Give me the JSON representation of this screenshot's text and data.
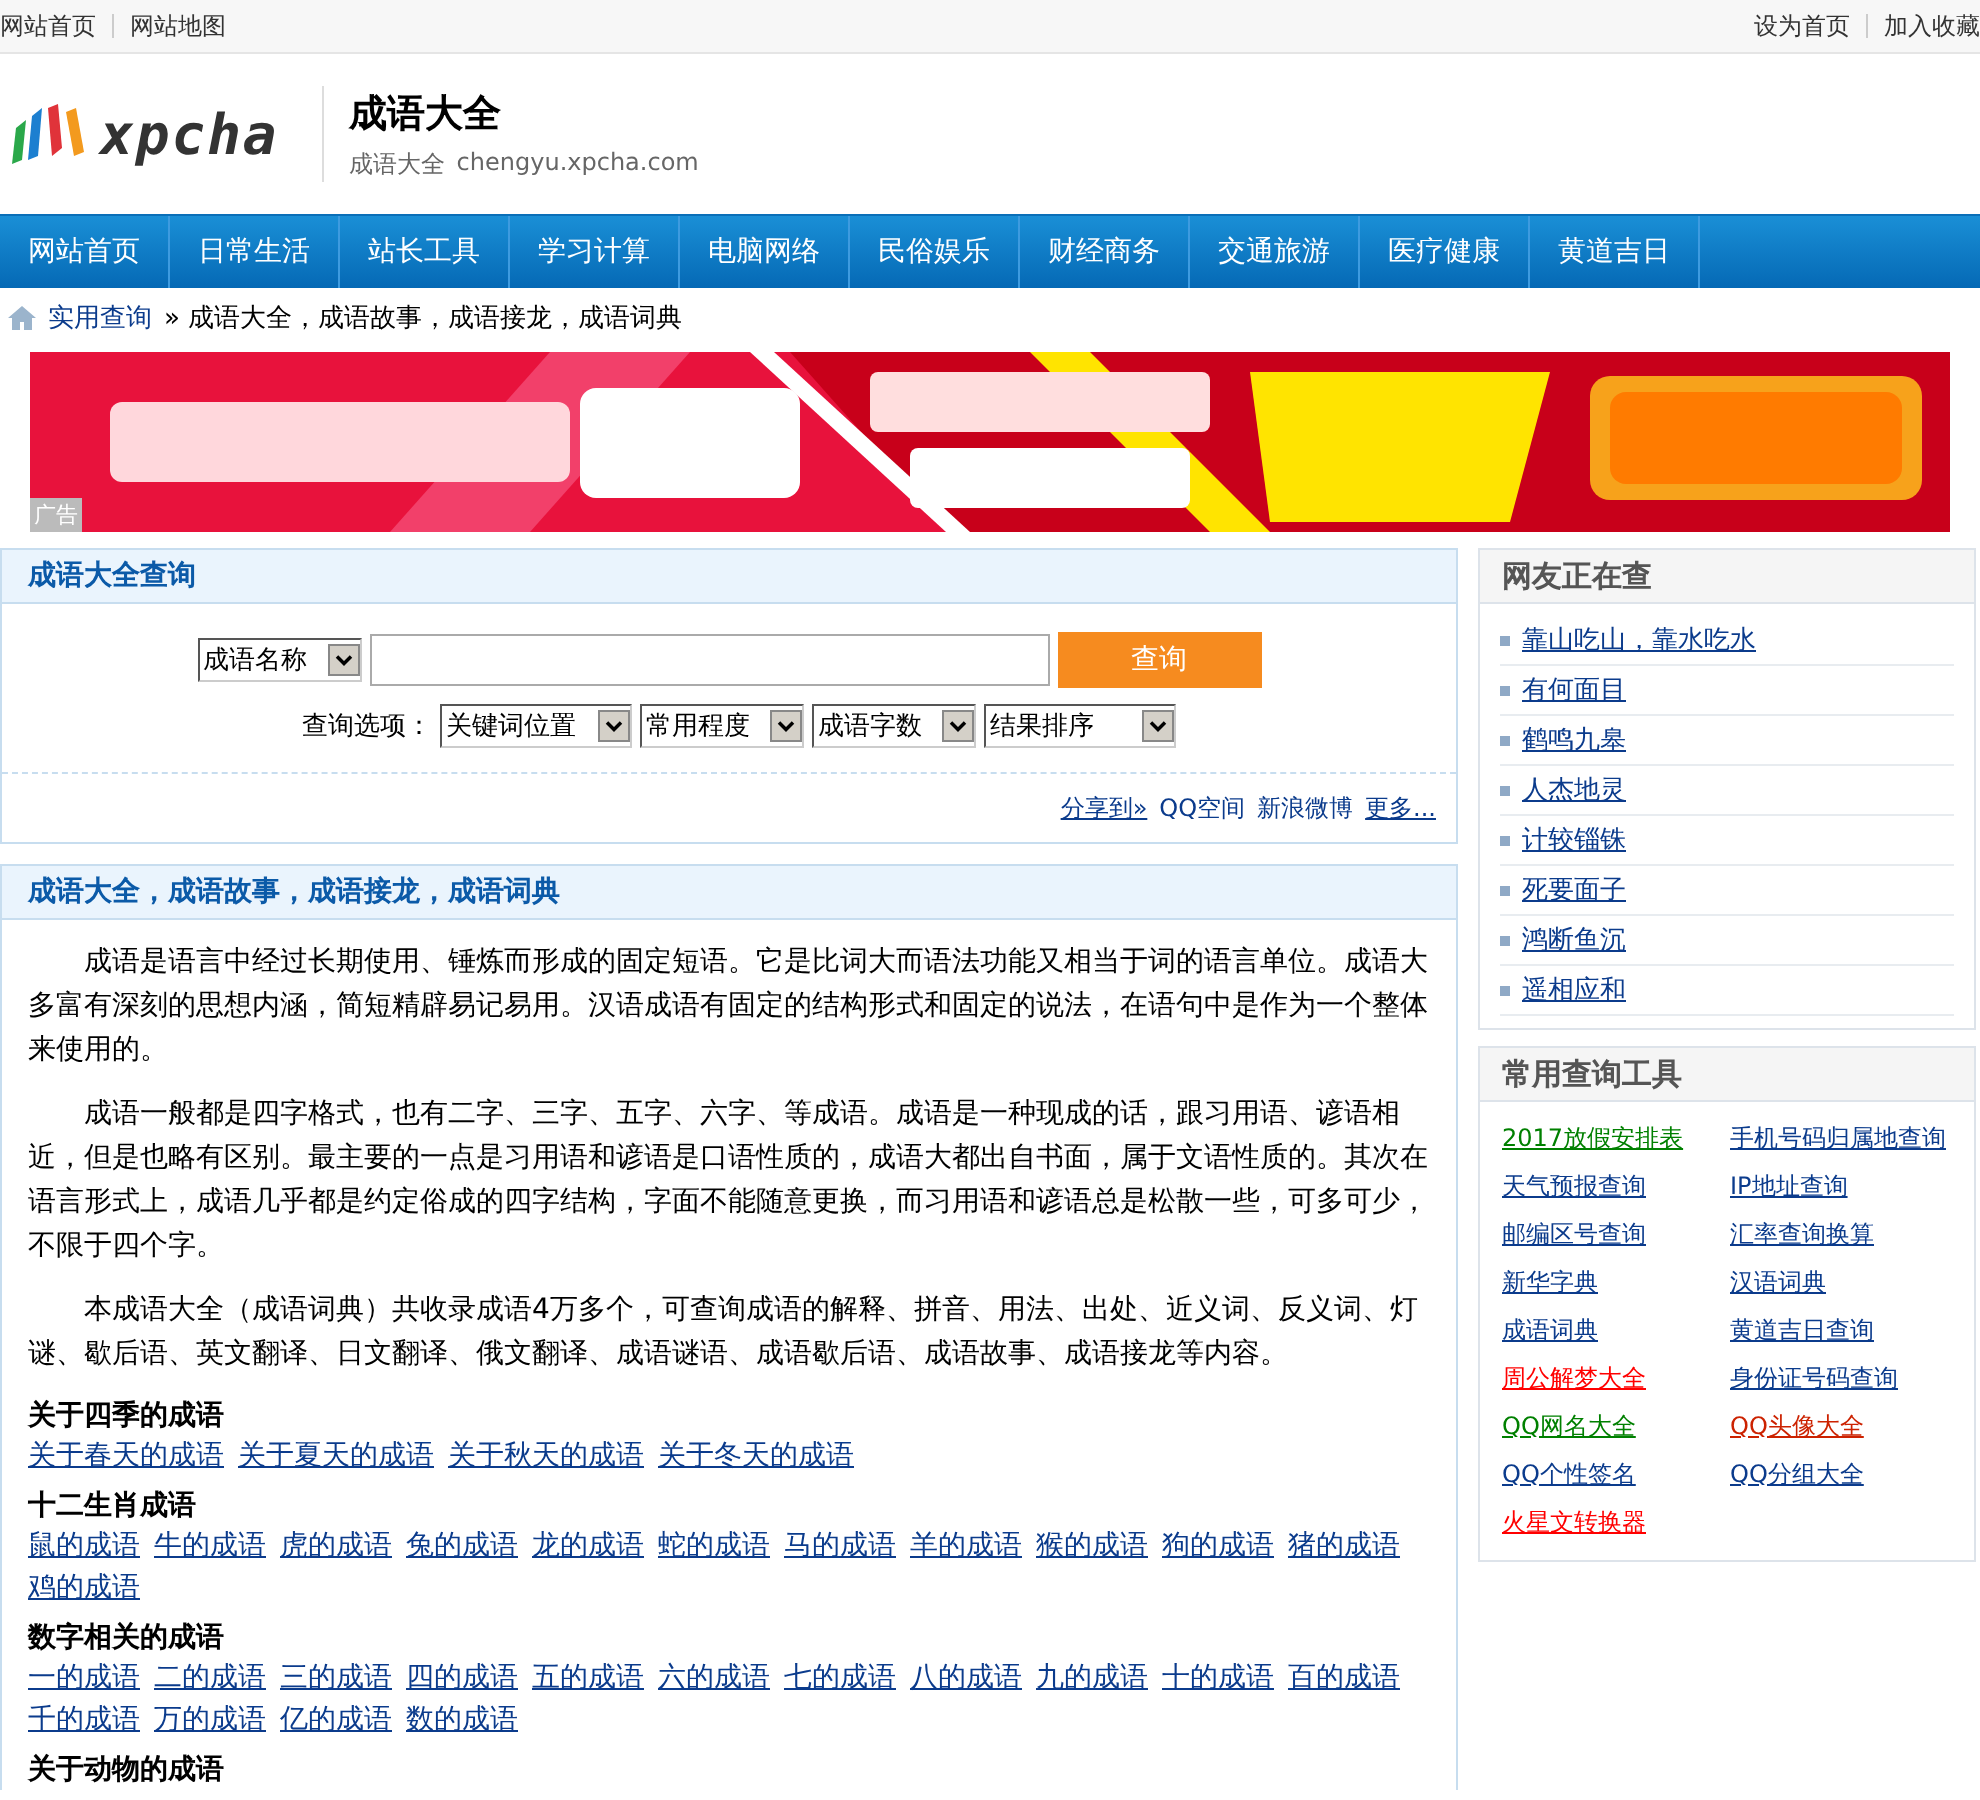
{
  "top_bar": {
    "left_links": [
      "网站首页",
      "网站地图"
    ],
    "right_links": [
      "设为首页",
      "加入收藏"
    ]
  },
  "header": {
    "logo_text": "xpcha",
    "title": "成语大全",
    "subtitle": "成语大全",
    "domain": "chengyu.xpcha.com"
  },
  "nav": [
    "网站首页",
    "日常生活",
    "站长工具",
    "学习计算",
    "电脑网络",
    "民俗娱乐",
    "财经商务",
    "交通旅游",
    "医疗健康",
    "黄道吉日"
  ],
  "breadcrumb": {
    "link": "实用查询",
    "rest": "» 成语大全，成语故事，成语接龙，成语词典"
  },
  "banner": {
    "kind": "picture",
    "ad_label": "广告"
  },
  "search_panel": {
    "title": "成语大全查询",
    "field_select": "成语名称",
    "button": "查询",
    "options_label": "查询选项：",
    "options": [
      "关键词位置",
      "常用程度",
      "成语字数",
      "结果排序"
    ],
    "share": {
      "label": "分享到»",
      "targets": [
        "QQ空间",
        "新浪微博"
      ],
      "more": "更多..."
    }
  },
  "intro_panel": {
    "title": "成语大全，成语故事，成语接龙，成语词典",
    "paragraphs": [
      "成语是语言中经过长期使用、锤炼而形成的固定短语。它是比词大而语法功能又相当于词的语言单位。成语大多富有深刻的思想内涵，简短精辟易记易用。汉语成语有固定的结构形式和固定的说法，在语句中是作为一个整体来使用的。",
      "成语一般都是四字格式，也有二字、三字、五字、六字、等成语。成语是一种现成的话，跟习用语、谚语相近，但是也略有区别。最主要的一点是习用语和谚语是口语性质的，成语大都出自书面，属于文语性质的。其次在语言形式上，成语几乎都是约定俗成的四字结构，字面不能随意更换，而习用语和谚语总是松散一些，可多可少，不限于四个字。",
      "本成语大全（成语词典）共收录成语4万多个，可查询成语的解释、拼音、用法、出处、近义词、反义词、灯谜、歇后语、英文翻译、日文翻译、俄文翻译、成语谜语、成语歇后语、成语故事、成语接龙等内容。"
    ],
    "categories": [
      {
        "heading": "关于四季的成语",
        "links": [
          "关于春天的成语",
          "关于夏天的成语",
          "关于秋天的成语",
          "关于冬天的成语"
        ]
      },
      {
        "heading": "十二生肖成语",
        "links": [
          "鼠的成语",
          "牛的成语",
          "虎的成语",
          "兔的成语",
          "龙的成语",
          "蛇的成语",
          "马的成语",
          "羊的成语",
          "猴的成语",
          "狗的成语",
          "猪的成语",
          "鸡的成语"
        ]
      },
      {
        "heading": "数字相关的成语",
        "links": [
          "一的成语",
          "二的成语",
          "三的成语",
          "四的成语",
          "五的成语",
          "六的成语",
          "七的成语",
          "八的成语",
          "九的成语",
          "十的成语",
          "百的成语",
          "千的成语",
          "万的成语",
          "亿的成语",
          "数的成语"
        ]
      },
      {
        "heading": "关于动物的成语"
      }
    ]
  },
  "trending": {
    "title": "网友正在查",
    "items": [
      "靠山吃山，靠水吃水",
      "有何面目",
      "鹤鸣九皋",
      "人杰地灵",
      "计较锱铢",
      "死要面子",
      "鸿断鱼沉",
      "遥相应和"
    ]
  },
  "tools": {
    "title": "常用查询工具",
    "items": [
      {
        "label": "2017放假安排表",
        "color": "#008000"
      },
      {
        "label": "手机号码归属地查询",
        "color": "#0b3b8c"
      },
      {
        "label": "天气预报查询",
        "color": "#0b3b8c"
      },
      {
        "label": "IP地址查询",
        "color": "#0b3b8c"
      },
      {
        "label": "邮编区号查询",
        "color": "#0b3b8c"
      },
      {
        "label": "汇率查询换算",
        "color": "#0b3b8c"
      },
      {
        "label": "新华字典",
        "color": "#0b3b8c"
      },
      {
        "label": "汉语词典",
        "color": "#0b3b8c"
      },
      {
        "label": "成语词典",
        "color": "#0b3b8c"
      },
      {
        "label": "黄道吉日查询",
        "color": "#0b3b8c"
      },
      {
        "label": "周公解梦大全",
        "color": "#ff0000"
      },
      {
        "label": "身份证号码查询",
        "color": "#0b3b8c"
      },
      {
        "label": "QQ网名大全",
        "color": "#008000"
      },
      {
        "label": "QQ头像大全",
        "color": "#cc2200"
      },
      {
        "label": "QQ个性签名",
        "color": "#0b3b8c"
      },
      {
        "label": "QQ分组大全",
        "color": "#0b3b8c"
      },
      {
        "label": "火星文转换器",
        "color": "#ff0000"
      }
    ]
  }
}
